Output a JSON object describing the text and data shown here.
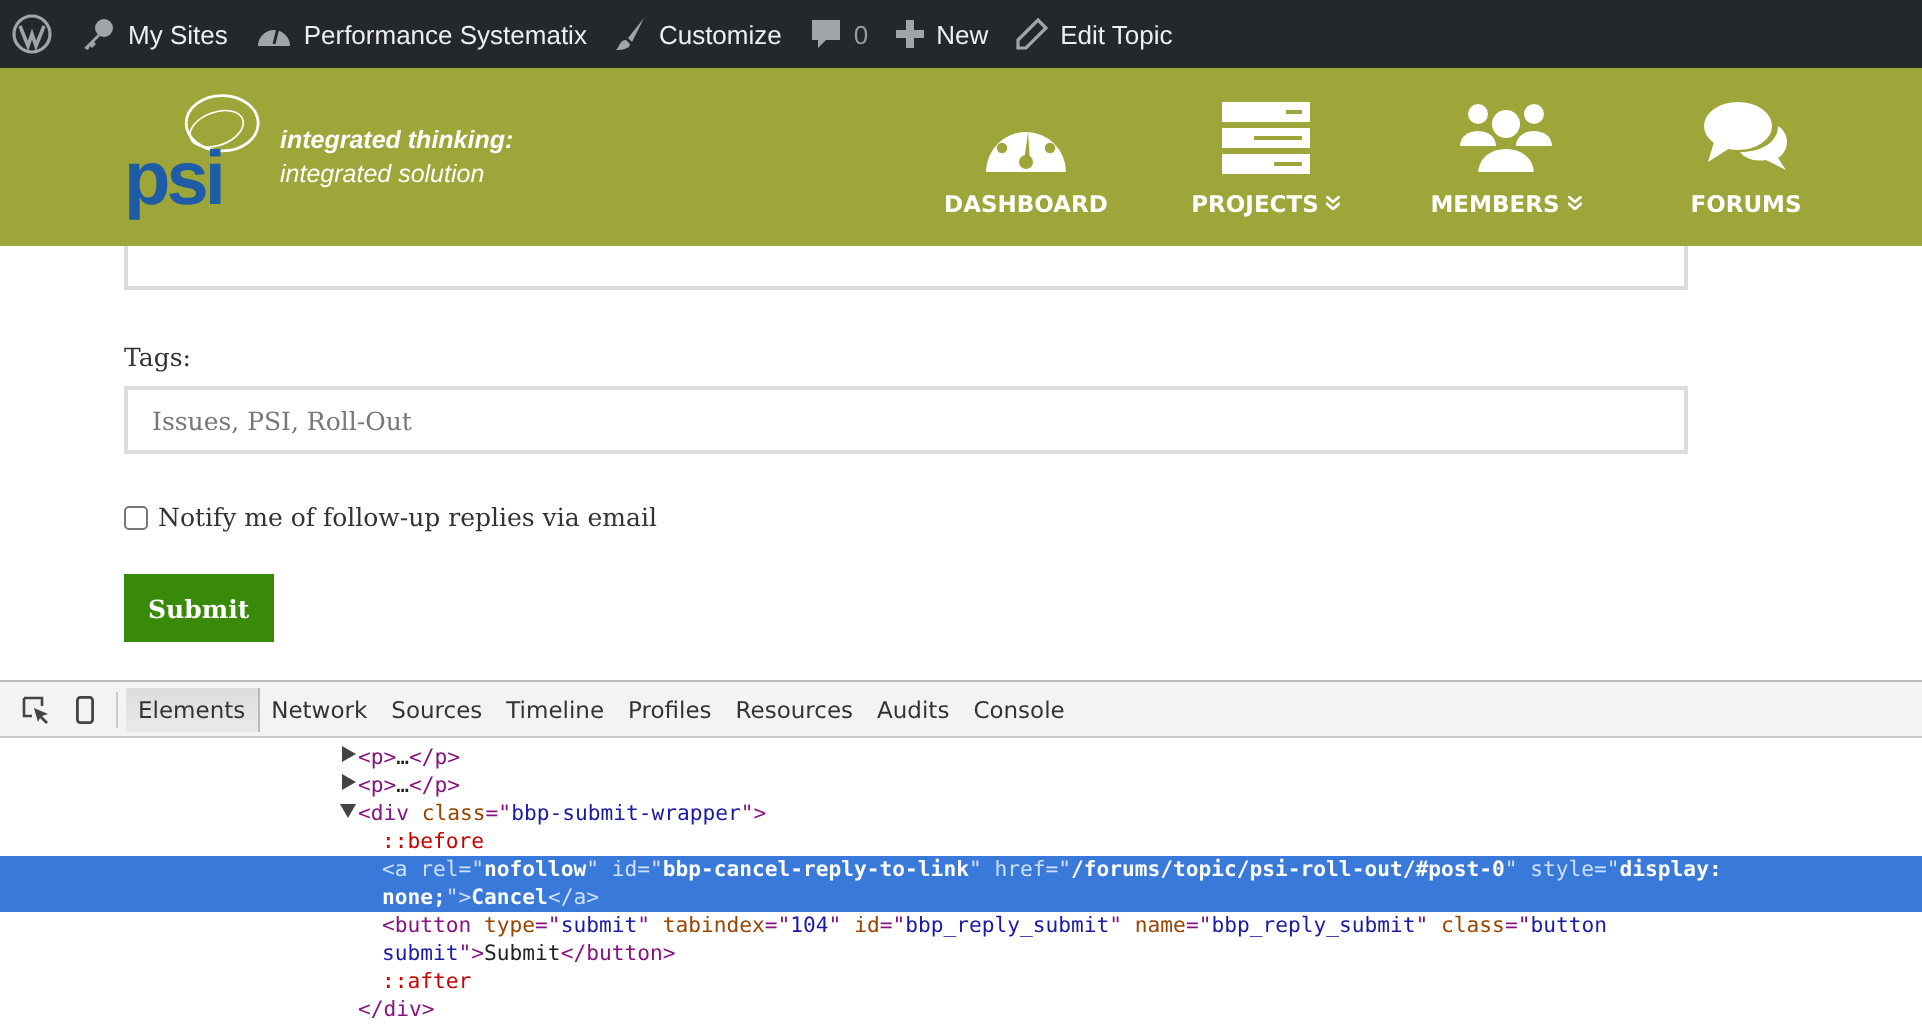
{
  "admin_bar": {
    "items": [
      {
        "kind": "wp"
      },
      {
        "kind": "key",
        "label": "My Sites"
      },
      {
        "kind": "gauge",
        "label": "Performance Systematix"
      },
      {
        "kind": "brush",
        "label": "Customize"
      },
      {
        "kind": "comment",
        "label": "0"
      },
      {
        "kind": "plus",
        "label": "New"
      },
      {
        "kind": "pencil",
        "label": "Edit Topic"
      }
    ]
  },
  "header": {
    "logo": {
      "text": "psi",
      "tagline_1": "integrated thinking:",
      "tagline_2": "integrated solution"
    },
    "nav": [
      {
        "kind": "gauge",
        "label": "DASHBOARD",
        "dropdown": false
      },
      {
        "kind": "stack",
        "label": "PROJECTS",
        "dropdown": true
      },
      {
        "kind": "people",
        "label": "MEMBERS",
        "dropdown": true
      },
      {
        "kind": "chat",
        "label": "FORUMS",
        "dropdown": false
      }
    ]
  },
  "form": {
    "tags_label": "Tags:",
    "tags_value": "Issues, PSI, Roll-Out",
    "notify": {
      "label": "Notify me of follow-up replies via email",
      "checked": false
    },
    "submit": "Submit"
  },
  "devtools": {
    "tabs": [
      {
        "label": "Elements",
        "selected": true
      },
      {
        "label": "Network",
        "selected": false
      },
      {
        "label": "Sources",
        "selected": false
      },
      {
        "label": "Timeline",
        "selected": false
      },
      {
        "label": "Profiles",
        "selected": false
      },
      {
        "label": "Resources",
        "selected": false
      },
      {
        "label": "Audits",
        "selected": false
      },
      {
        "label": "Console",
        "selected": false
      }
    ],
    "nodes": [
      {
        "expanded": false,
        "selected": false,
        "tokens": [
          {
            "kind": "tag",
            "text": "<p>"
          },
          {
            "kind": "text",
            "text": "…"
          },
          {
            "kind": "tag",
            "text": "</p>"
          }
        ]
      },
      {
        "expanded": false,
        "selected": false,
        "tokens": [
          {
            "kind": "tag",
            "text": "<p>"
          },
          {
            "kind": "text",
            "text": "…"
          },
          {
            "kind": "tag",
            "text": "</p>"
          }
        ]
      },
      {
        "expanded": true,
        "selected": false,
        "tokens": [
          {
            "kind": "tag",
            "text": "<div"
          },
          {
            "kind": "attr",
            "text": " class"
          },
          {
            "kind": "tag",
            "text": "=\""
          },
          {
            "kind": "value",
            "text": "bbp-submit-wrapper"
          },
          {
            "kind": "tag",
            "text": "\">"
          }
        ],
        "children": [
          {
            "selected": false,
            "tokens": [
              {
                "kind": "pseudo",
                "text": "::before"
              }
            ]
          },
          {
            "selected": true,
            "tokens": [
              {
                "kind": "tag",
                "text": "<a"
              },
              {
                "kind": "attr",
                "text": " rel"
              },
              {
                "kind": "tag",
                "text": "=\""
              },
              {
                "kind": "value",
                "text": "nofollow"
              },
              {
                "kind": "tag",
                "text": "\""
              },
              {
                "kind": "attr",
                "text": " id"
              },
              {
                "kind": "tag",
                "text": "=\""
              },
              {
                "kind": "value",
                "text": "bbp-cancel-reply-to-link"
              },
              {
                "kind": "tag",
                "text": "\""
              },
              {
                "kind": "attr",
                "text": " href"
              },
              {
                "kind": "tag",
                "text": "=\""
              },
              {
                "kind": "value",
                "text": "/forums/topic/psi-roll-out/#post-0"
              },
              {
                "kind": "tag",
                "text": "\""
              },
              {
                "kind": "attr",
                "text": " style"
              },
              {
                "kind": "tag",
                "text": "=\""
              },
              {
                "kind": "value",
                "text": "display: none;"
              },
              {
                "kind": "tag",
                "text": "\">"
              },
              {
                "kind": "text",
                "text": "Cancel"
              },
              {
                "kind": "tag",
                "text": "</a>"
              }
            ]
          },
          {
            "selected": false,
            "tokens": [
              {
                "kind": "tag",
                "text": "<button"
              },
              {
                "kind": "attr",
                "text": " type"
              },
              {
                "kind": "tag",
                "text": "=\""
              },
              {
                "kind": "value",
                "text": "submit"
              },
              {
                "kind": "tag",
                "text": "\""
              },
              {
                "kind": "attr",
                "text": " tabindex"
              },
              {
                "kind": "tag",
                "text": "=\""
              },
              {
                "kind": "value",
                "text": "104"
              },
              {
                "kind": "tag",
                "text": "\""
              },
              {
                "kind": "attr",
                "text": " id"
              },
              {
                "kind": "tag",
                "text": "=\""
              },
              {
                "kind": "value",
                "text": "bbp_reply_submit"
              },
              {
                "kind": "tag",
                "text": "\""
              },
              {
                "kind": "attr",
                "text": " name"
              },
              {
                "kind": "tag",
                "text": "=\""
              },
              {
                "kind": "value",
                "text": "bbp_reply_submit"
              },
              {
                "kind": "tag",
                "text": "\""
              },
              {
                "kind": "attr",
                "text": " class"
              },
              {
                "kind": "tag",
                "text": "=\""
              },
              {
                "kind": "value",
                "text": "button submit"
              },
              {
                "kind": "tag",
                "text": "\">"
              },
              {
                "kind": "text",
                "text": "Submit"
              },
              {
                "kind": "tag",
                "text": "</button>"
              }
            ]
          },
          {
            "selected": false,
            "tokens": [
              {
                "kind": "pseudo",
                "text": "::after"
              }
            ]
          }
        ],
        "closing": [
          {
            "kind": "tag",
            "text": "</div>"
          }
        ]
      }
    ]
  }
}
